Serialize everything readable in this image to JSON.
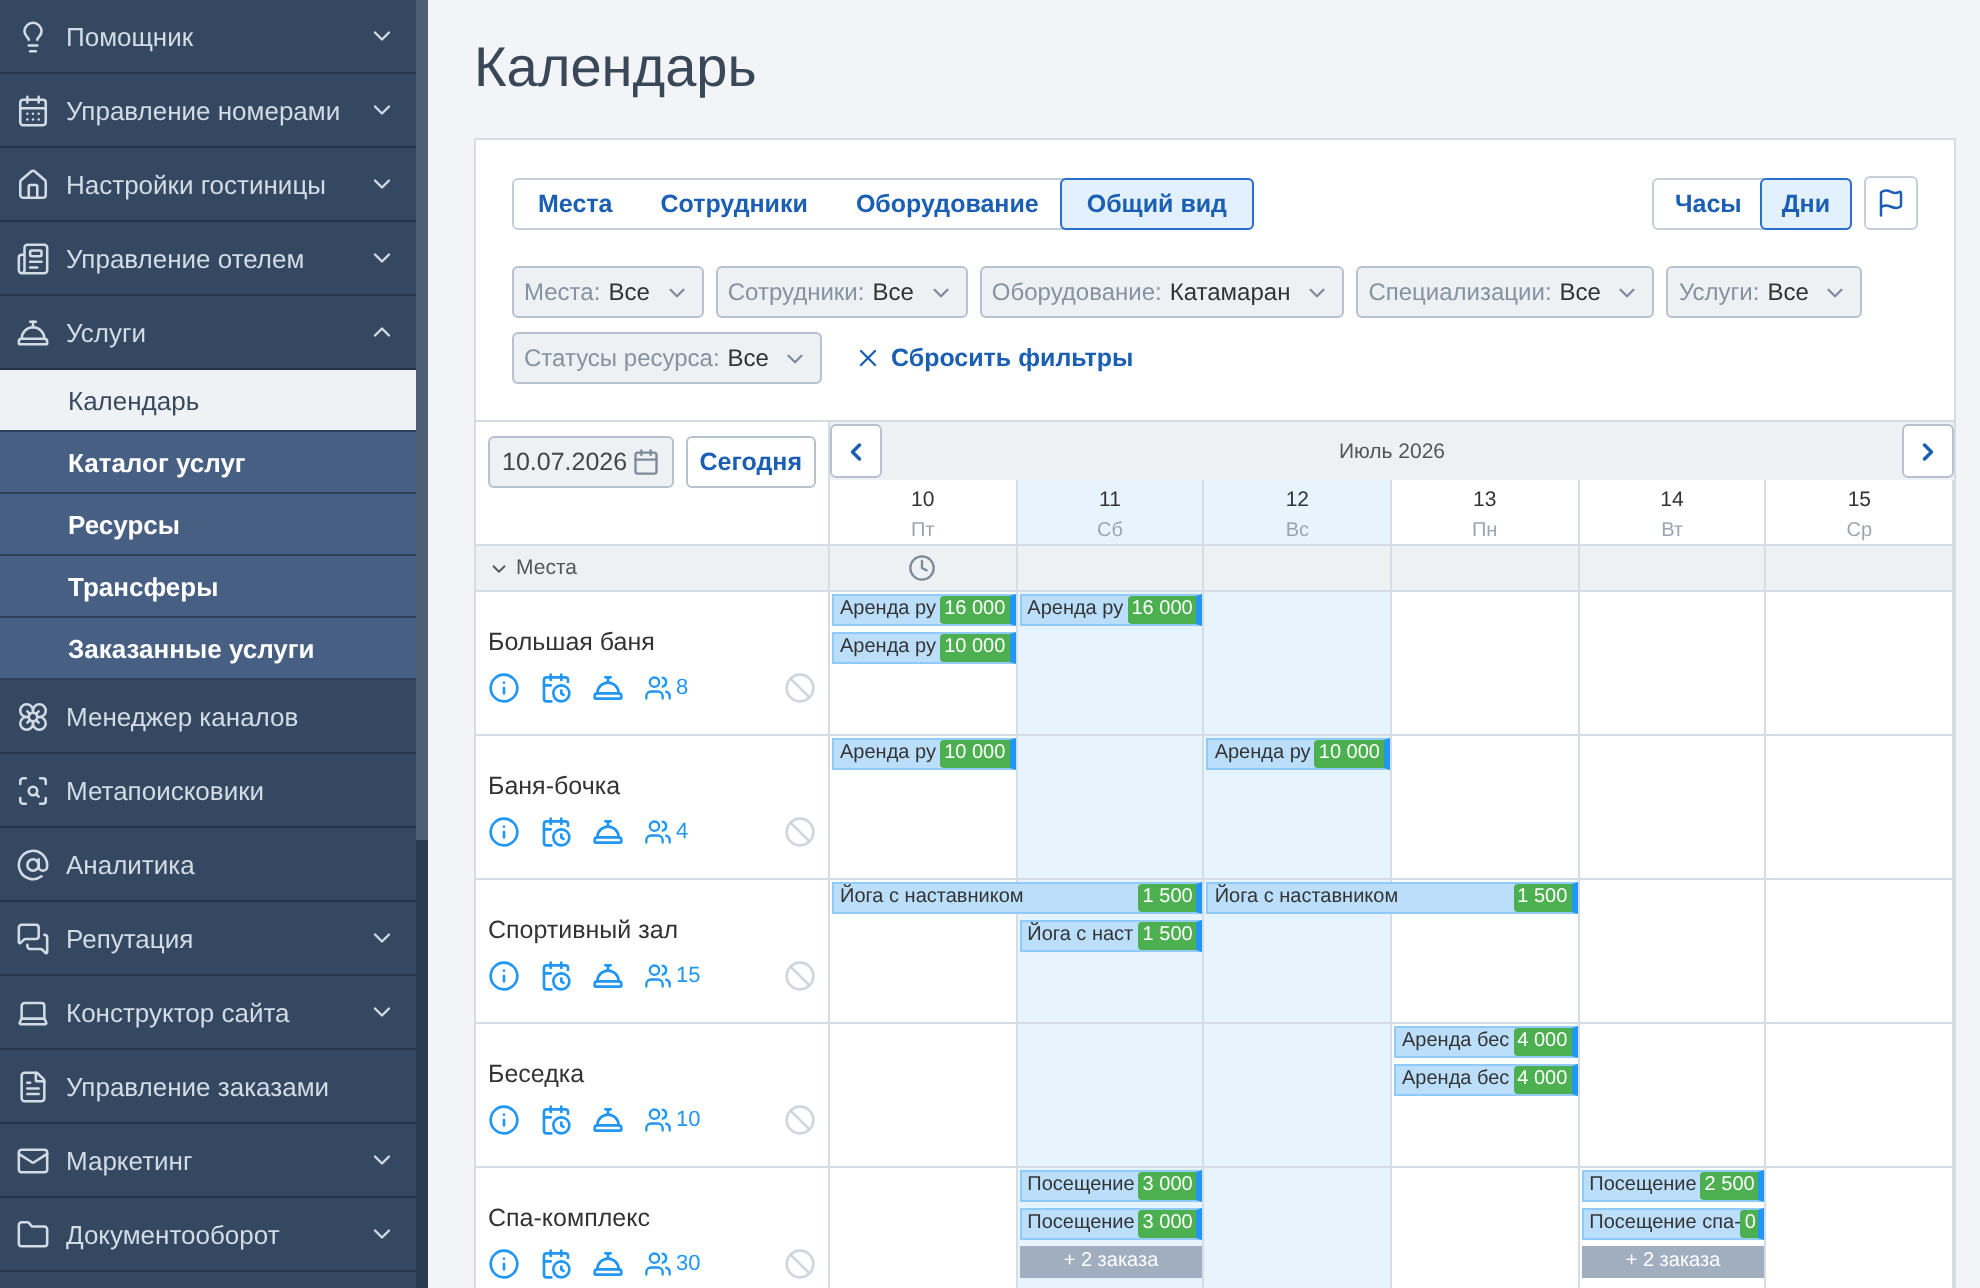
{
  "sidebar": {
    "items": [
      {
        "label": "Помощник",
        "kind": "group",
        "expanded": false
      },
      {
        "label": "Управление номерами",
        "kind": "group",
        "expanded": false
      },
      {
        "label": "Настройки гостиницы",
        "kind": "group",
        "expanded": false
      },
      {
        "label": "Управление отелем",
        "kind": "group",
        "expanded": false
      },
      {
        "label": "Услуги",
        "kind": "group",
        "expanded": true,
        "children": [
          {
            "label": "Календарь",
            "selected": true
          },
          {
            "label": "Каталог услуг",
            "selected": false
          },
          {
            "label": "Ресурсы",
            "selected": false
          },
          {
            "label": "Трансферы",
            "selected": false
          },
          {
            "label": "Заказанные услуги",
            "selected": false
          }
        ]
      },
      {
        "label": "Менеджер каналов",
        "kind": "link"
      },
      {
        "label": "Метапоисковики",
        "kind": "link"
      },
      {
        "label": "Аналитика",
        "kind": "link"
      },
      {
        "label": "Репутация",
        "kind": "group",
        "expanded": false
      },
      {
        "label": "Конструктор сайта",
        "kind": "group",
        "expanded": false
      },
      {
        "label": "Управление заказами",
        "kind": "link"
      },
      {
        "label": "Маркетинг",
        "kind": "group",
        "expanded": false
      },
      {
        "label": "Документооборот",
        "kind": "group",
        "expanded": false
      }
    ]
  },
  "page": {
    "title": "Календарь"
  },
  "view_tabs": [
    {
      "label": "Места",
      "selected": false
    },
    {
      "label": "Сотрудники",
      "selected": false
    },
    {
      "label": "Оборудование",
      "selected": false
    },
    {
      "label": "Общий вид",
      "selected": true
    }
  ],
  "scale_tabs": [
    {
      "label": "Часы",
      "selected": false
    },
    {
      "label": "Дни",
      "selected": true
    }
  ],
  "filters": [
    {
      "label": "Места:",
      "value": "Все"
    },
    {
      "label": "Сотрудники:",
      "value": "Все"
    },
    {
      "label": "Оборудование:",
      "value": "Катамаран"
    },
    {
      "label": "Специализации:",
      "value": "Все"
    },
    {
      "label": "Услуги:",
      "value": "Все"
    },
    {
      "label": "Статусы ресурса:",
      "value": "Все"
    }
  ],
  "reset_filters": "Сбросить фильтры",
  "date_field": {
    "value": "10.07.2026"
  },
  "today_button": "Сегодня",
  "month_label": "Июль 2026",
  "days": [
    {
      "number": "10",
      "weekday": "Пт",
      "weekend": false
    },
    {
      "number": "11",
      "weekday": "Сб",
      "weekend": true
    },
    {
      "number": "12",
      "weekday": "Вс",
      "weekend": true
    },
    {
      "number": "13",
      "weekday": "Пн",
      "weekend": false
    },
    {
      "number": "14",
      "weekday": "Вт",
      "weekend": false
    },
    {
      "number": "15",
      "weekday": "Ср",
      "weekend": false
    }
  ],
  "group": {
    "label": "Места",
    "expanded": true
  },
  "resources": [
    {
      "name": "Большая баня",
      "capacity": "8",
      "cells": [
        {
          "events": [
            {
              "kind": "booking",
              "label": "Аренда ру",
              "price": "16 000",
              "wide": false
            },
            {
              "kind": "booking",
              "label": "Аренда ру",
              "price": "10 000",
              "wide": false
            }
          ]
        },
        {
          "events": [
            {
              "kind": "booking",
              "label": "Аренда ру",
              "price": "16 000",
              "wide": false
            }
          ]
        },
        {},
        {},
        {},
        {}
      ]
    },
    {
      "name": "Баня-бочка",
      "capacity": "4",
      "cells": [
        {
          "events": [
            {
              "kind": "booking",
              "label": "Аренда ру",
              "price": "10 000",
              "wide": false
            }
          ]
        },
        {},
        {
          "events": [
            {
              "kind": "booking",
              "label": "Аренда ру",
              "price": "10 000",
              "wide": false
            }
          ]
        },
        {},
        {},
        {}
      ]
    },
    {
      "name": "Спортивный зал",
      "capacity": "15",
      "cells": [
        {
          "events": [
            {
              "kind": "booking",
              "label": "Йога с наставником",
              "price": "1 500",
              "wide": true
            }
          ]
        },
        {
          "events": [
            {
              "kind": "booking",
              "label": "Йога с наст",
              "price": "1 500",
              "wide": false
            }
          ]
        },
        {
          "events": [
            {
              "kind": "booking",
              "label": "Йога с наставником",
              "price": "1 500",
              "wide": true
            }
          ]
        },
        {},
        {},
        {}
      ]
    },
    {
      "name": "Беседка",
      "capacity": "10",
      "cells": [
        {},
        {},
        {},
        {
          "events": [
            {
              "kind": "booking",
              "label": "Аренда бес",
              "price": "4 000",
              "wide": false
            },
            {
              "kind": "booking",
              "label": "Аренда бес",
              "price": "4 000",
              "wide": false
            }
          ]
        },
        {},
        {}
      ]
    },
    {
      "name": "Спа-комплекс",
      "capacity": "30",
      "cells": [
        {},
        {
          "events": [
            {
              "kind": "booking",
              "label": "Посещение",
              "price": "3 000",
              "wide": false
            },
            {
              "kind": "booking",
              "label": "Посещение",
              "price": "3 000",
              "wide": false
            },
            {
              "kind": "more",
              "label": "+ 2 заказа"
            }
          ]
        },
        {},
        {},
        {
          "events": [
            {
              "kind": "booking",
              "label": "Посещение",
              "price": "2 500",
              "wide": false
            },
            {
              "kind": "booking",
              "label": "Посещение спа-",
              "price": "0",
              "wide": false
            },
            {
              "kind": "more",
              "label": "+ 2 заказа"
            }
          ]
        },
        {}
      ]
    }
  ]
}
